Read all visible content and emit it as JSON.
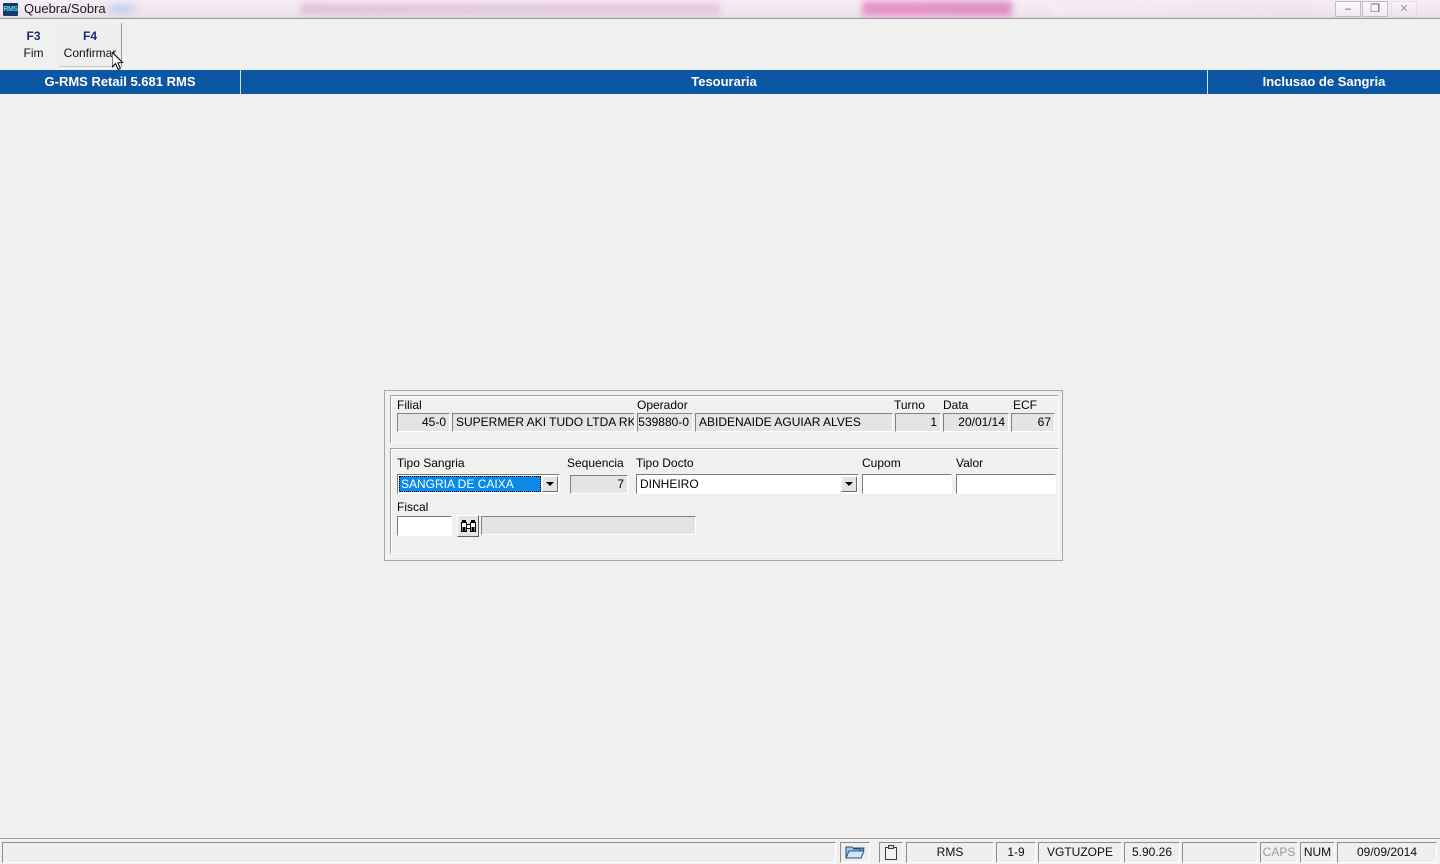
{
  "window": {
    "app_icon": "rms-logo-icon",
    "title": "Quebra/Sobra",
    "minimize_glyph": "–",
    "maximize_glyph": "❐",
    "close_glyph": "✕"
  },
  "toolbar": {
    "keys": [
      {
        "code": "F3",
        "label": "Fim",
        "hot": false
      },
      {
        "code": "F4",
        "label": "Confirmar",
        "hot": true
      }
    ]
  },
  "module_bar": {
    "system": "G-RMS Retail 5.681 RMS",
    "module": "Tesouraria",
    "screen": "Inclusao de Sangria",
    "background_color": "#0b57a4",
    "text_color": "#ffffff"
  },
  "form": {
    "header_group": {
      "filial": {
        "label": "Filial",
        "code": "45-0",
        "name": "SUPERMER AKI TUDO LTDA RK",
        "name_clipped_line": "45-0"
      },
      "operador": {
        "label": "Operador",
        "code": "539880-0",
        "name": "ABIDENAIDE AGUIAR ALVES"
      },
      "turno": {
        "label": "Turno",
        "value": "1"
      },
      "data": {
        "label": "Data",
        "value": "20/01/14"
      },
      "ecf": {
        "label": "ECF",
        "value": "67"
      }
    },
    "body_group": {
      "tipo_sangria": {
        "label": "Tipo Sangria",
        "value": "SANGRIA DE CAIXA",
        "selected": true,
        "highlight_color": "#0a8ae8"
      },
      "sequencia": {
        "label": "Sequencia",
        "value": "7"
      },
      "tipo_docto": {
        "label": "Tipo Docto",
        "value": "DINHEIRO"
      },
      "cupom": {
        "label": "Cupom",
        "value": ""
      },
      "valor": {
        "label": "Valor",
        "value": ""
      },
      "fiscal": {
        "label": "Fiscal",
        "code_value": "",
        "description_value": "",
        "find_icon": "binoculars-icon"
      }
    }
  },
  "statusbar": {
    "message": "",
    "folder_icon": "folder-icon",
    "clipboard_icon": "clipboard-icon",
    "cells": [
      {
        "name": "system",
        "text": "RMS"
      },
      {
        "name": "session",
        "text": "1-9"
      },
      {
        "name": "user",
        "text": "VGTUZOPE"
      },
      {
        "name": "version",
        "text": "5.90.26"
      },
      {
        "name": "spare",
        "text": ""
      },
      {
        "name": "caps",
        "text": "CAPS",
        "dim": true
      },
      {
        "name": "num",
        "text": "NUM",
        "dim": false
      },
      {
        "name": "date",
        "text": "09/09/2014"
      }
    ]
  }
}
